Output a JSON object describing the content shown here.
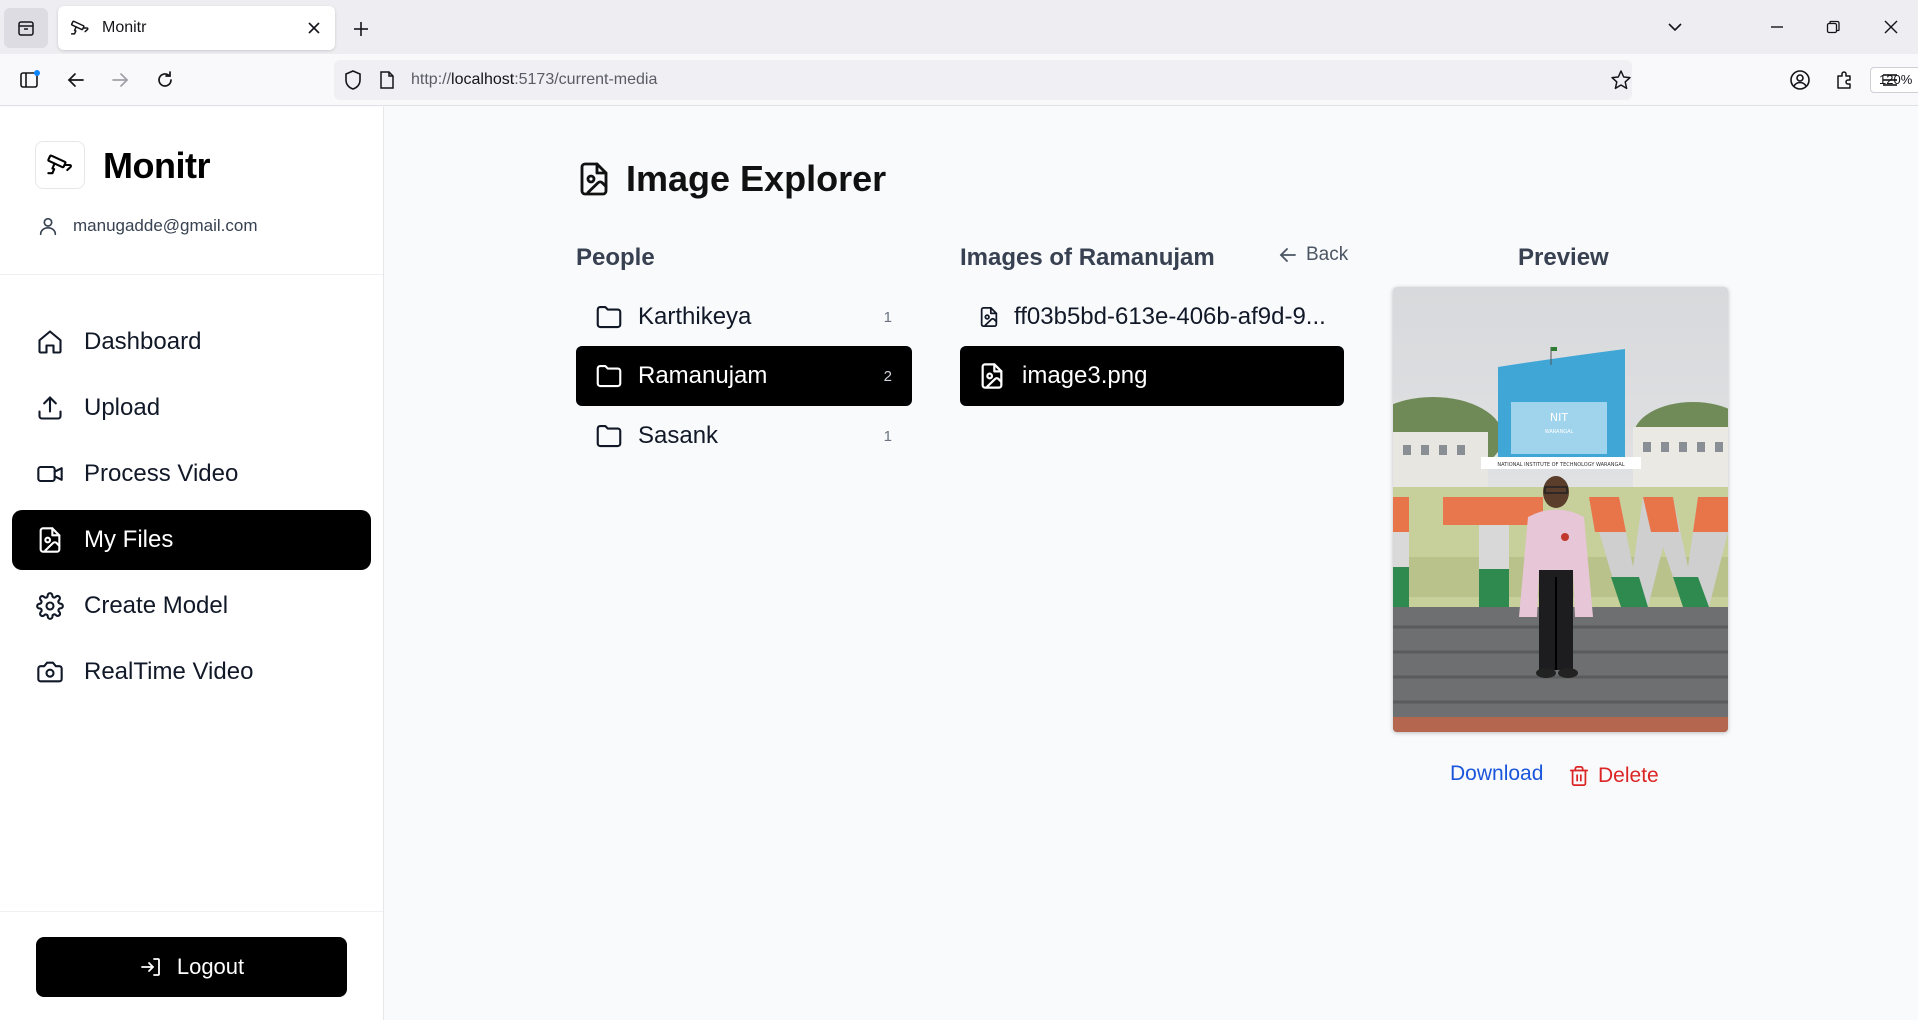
{
  "browser": {
    "tab_title": "Monitr",
    "url_prefix": "http://",
    "url_host": "localhost",
    "url_rest": ":5173/current-media",
    "zoom": "120%"
  },
  "sidebar": {
    "app_name": "Monitr",
    "user_email": "manugadde@gmail.com",
    "items": [
      {
        "label": "Dashboard",
        "icon": "home-icon"
      },
      {
        "label": "Upload",
        "icon": "upload-icon"
      },
      {
        "label": "Process Video",
        "icon": "video-icon"
      },
      {
        "label": "My Files",
        "icon": "file-image-icon",
        "active": true
      },
      {
        "label": "Create Model",
        "icon": "gear-icon"
      },
      {
        "label": "RealTime Video",
        "icon": "camera-icon"
      }
    ],
    "logout_label": "Logout"
  },
  "main": {
    "title": "Image Explorer",
    "people_header": "People",
    "images_header": "Images of Ramanujam",
    "back_label": "Back",
    "preview_header": "Preview",
    "people": [
      {
        "name": "Karthikeya",
        "count": "1"
      },
      {
        "name": "Ramanujam",
        "count": "2",
        "active": true
      },
      {
        "name": "Sasank",
        "count": "1"
      }
    ],
    "images": [
      {
        "name": "ff03b5bd-613e-406b-af9d-9..."
      },
      {
        "name": "image3.png",
        "active": true
      }
    ],
    "preview_sign_text": "NIT",
    "preview_sign_sub": "WARANGAL",
    "preview_banner_text": "NATIONAL INSTITUTE OF TECHNOLOGY WARANGAL",
    "download_label": "Download",
    "delete_label": "Delete"
  },
  "colors": {
    "accent": "#000000",
    "link_blue": "#1a56db",
    "delete_red": "#dc2626"
  }
}
